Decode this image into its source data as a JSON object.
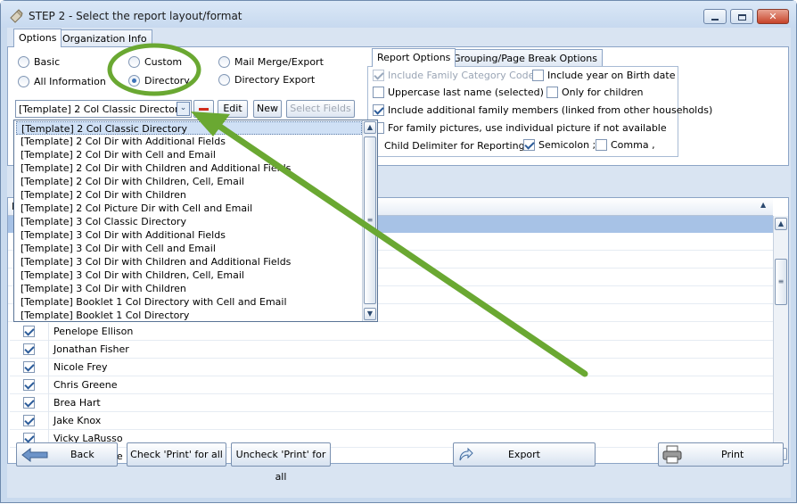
{
  "window": {
    "title": "STEP 2 - Select the report layout/format"
  },
  "tabs": {
    "options": "Options",
    "org_info": "Organization Info"
  },
  "format_options": {
    "basic": "Basic",
    "all_info": "All Information",
    "custom": "Custom",
    "directory": "Directory",
    "mail_merge": "Mail Merge/Export",
    "directory_export": "Directory Export"
  },
  "template": {
    "selected": "[Template] 2 Col Classic Directory",
    "edit": "Edit",
    "new": "New",
    "select_fields": "Select Fields",
    "options": [
      "[Template] 2 Col Classic Directory",
      "[Template] 2 Col Dir with Additional Fields",
      "[Template] 2 Col Dir with Cell and Email",
      "[Template] 2 Col Dir with Children and Additional Fields",
      "[Template] 2 Col Dir with Children, Cell, Email",
      "[Template] 2 Col Dir with Children",
      "[Template] 2 Col Picture Dir with Cell and Email",
      "[Template] 3 Col Classic Directory",
      "[Template] 3 Col Dir with Additional Fields",
      "[Template] 3 Col Dir with Cell and Email",
      "[Template] 3 Col Dir with Children and Additional Fields",
      "[Template] 3 Col Dir with Children, Cell, Email",
      "[Template] 3 Col Dir with Children",
      "[Template] Booklet 1 Col Directory with Cell and Email",
      "[Template] Booklet 1 Col Directory"
    ]
  },
  "report_options": {
    "tab_report": "Report Options",
    "tab_grouping": "Grouping/Page Break Options",
    "include_family_category": "Include Family Category Codes",
    "include_year_birth": "Include year on Birth date",
    "uppercase_last_name": "Uppercase last name (selected)",
    "only_children": "Only for children",
    "include_additional_members": "Include additional family members (linked from other households)",
    "family_pictures": "For family pictures, use individual picture if not available",
    "child_delimiter_label": "Child Delimiter for Reporting:",
    "semicolon": "Semicolon ;",
    "comma": "Comma ,"
  },
  "grid": {
    "header_fragment": "P",
    "rows": [
      "Penelope Ellison",
      "Jonathan Fisher",
      "Nicole Frey",
      "Chris Greene",
      "Brea Hart",
      "Jake Knox",
      "Vicky LaRusso",
      "Erin Lawrence"
    ]
  },
  "footer": {
    "back": "Back",
    "check_all": "Check 'Print' for all",
    "uncheck_all": "Uncheck 'Print' for all",
    "export": "Export",
    "print": "Print"
  },
  "colors": {
    "annotation_green": "#6aa832",
    "selection_blue": "#a7c2e6"
  }
}
